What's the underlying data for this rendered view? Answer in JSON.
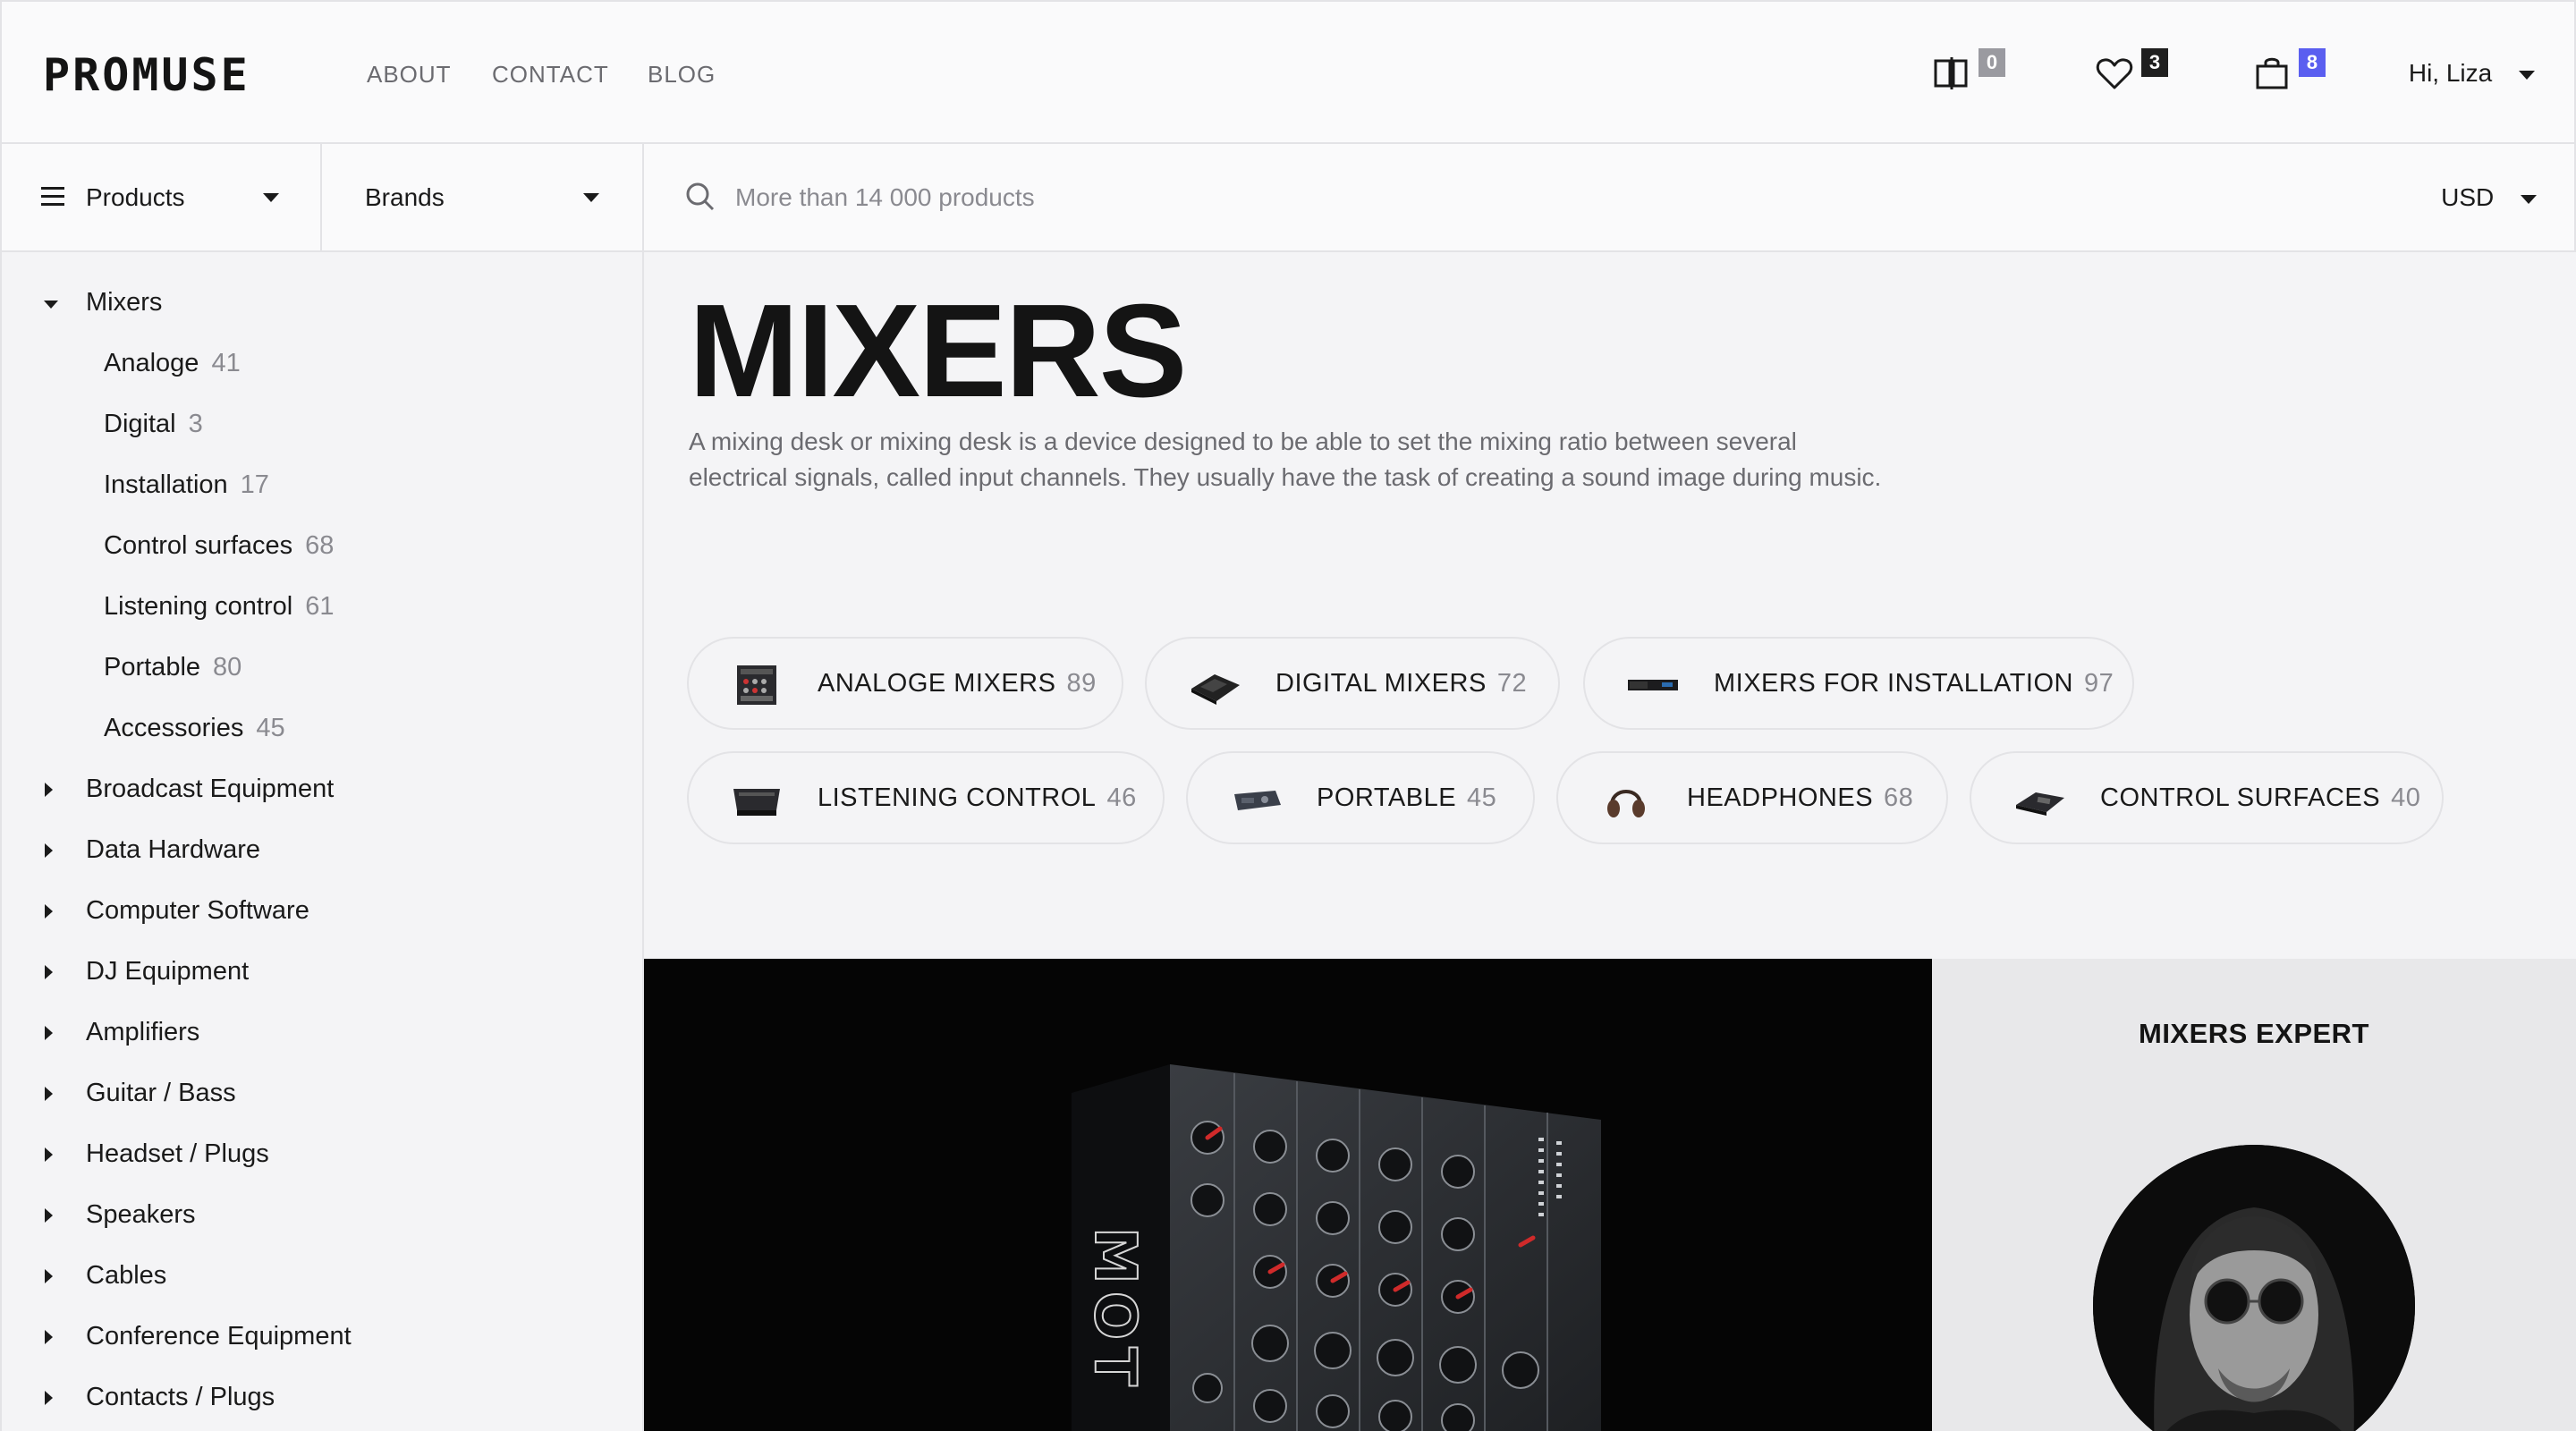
{
  "header": {
    "logo": "PROMUSE",
    "nav": [
      "ABOUT",
      "CONTACT",
      "BLOG"
    ],
    "compare_count": "0",
    "wishlist_count": "3",
    "cart_count": "8",
    "user_greeting": "Hi, Liza",
    "badge_colors": {
      "compare": "#9a9aa0",
      "wishlist": "#1f1f1f",
      "cart": "#5a5ef0"
    }
  },
  "subbar": {
    "products_label": "Products",
    "brands_label": "Brands",
    "search_placeholder": "More than 14 000 products",
    "currency": "USD"
  },
  "sidebar": {
    "expanded": {
      "label": "Mixers"
    },
    "subcategories": [
      {
        "label": "Analoge",
        "count": "41"
      },
      {
        "label": "Digital",
        "count": "3"
      },
      {
        "label": "Installation",
        "count": "17"
      },
      {
        "label": "Control surfaces",
        "count": "68"
      },
      {
        "label": "Listening control",
        "count": "61"
      },
      {
        "label": "Portable",
        "count": "80"
      },
      {
        "label": "Accessories",
        "count": "45"
      }
    ],
    "categories": [
      {
        "label": "Broadcast Equipment"
      },
      {
        "label": "Data Hardware"
      },
      {
        "label": "Computer Software"
      },
      {
        "label": "DJ Equipment"
      },
      {
        "label": "Amplifiers"
      },
      {
        "label": "Guitar / Bass"
      },
      {
        "label": "Headset / Plugs"
      },
      {
        "label": "Speakers"
      },
      {
        "label": "Cables"
      },
      {
        "label": "Conference Equipment"
      },
      {
        "label": "Contacts / Plugs"
      }
    ]
  },
  "main": {
    "title": "MIXERS",
    "description": "A mixing desk or mixing desk is a device designed to be able to set the mixing ratio between several electrical signals, called input channels. They usually have the task of creating a sound image during music.",
    "chips": [
      {
        "label": "ANALOGE MIXERS",
        "count": "89",
        "icon": "analog-mixer-icon"
      },
      {
        "label": "DIGITAL MIXERS",
        "count": "72",
        "icon": "digital-mixer-icon"
      },
      {
        "label": "MIXERS FOR INSTALLATION",
        "count": "97",
        "icon": "rack-mixer-icon"
      },
      {
        "label": "LISTENING CONTROL",
        "count": "46",
        "icon": "listening-control-icon"
      },
      {
        "label": "PORTABLE",
        "count": "45",
        "icon": "portable-mixer-icon"
      },
      {
        "label": "HEADPHONES",
        "count": "68",
        "icon": "headphones-icon"
      },
      {
        "label": "CONTROL SURFACES",
        "count": "40",
        "icon": "control-surface-icon"
      }
    ],
    "hero_brand_text": "MOT",
    "expert_title": "MIXERS EXPERT"
  }
}
